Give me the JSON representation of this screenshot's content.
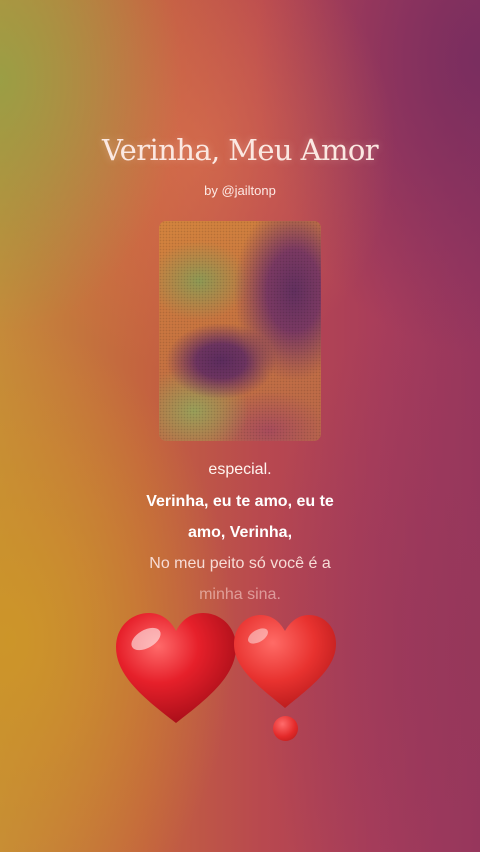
{
  "song": {
    "title": "Verinha, Meu Amor",
    "artist_line": "by @jailtonp"
  },
  "lyrics": [
    "especial.",
    "Verinha, eu te amo, eu te",
    "amo, Verinha,",
    "No meu peito só você é a",
    "minha sina."
  ],
  "decorations": {
    "heart_large": "red-heart-icon",
    "heart_exclamation": "heart-exclamation-icon"
  },
  "colors": {
    "heart_red": "#e02424",
    "title_text": "#fbe8e2"
  }
}
